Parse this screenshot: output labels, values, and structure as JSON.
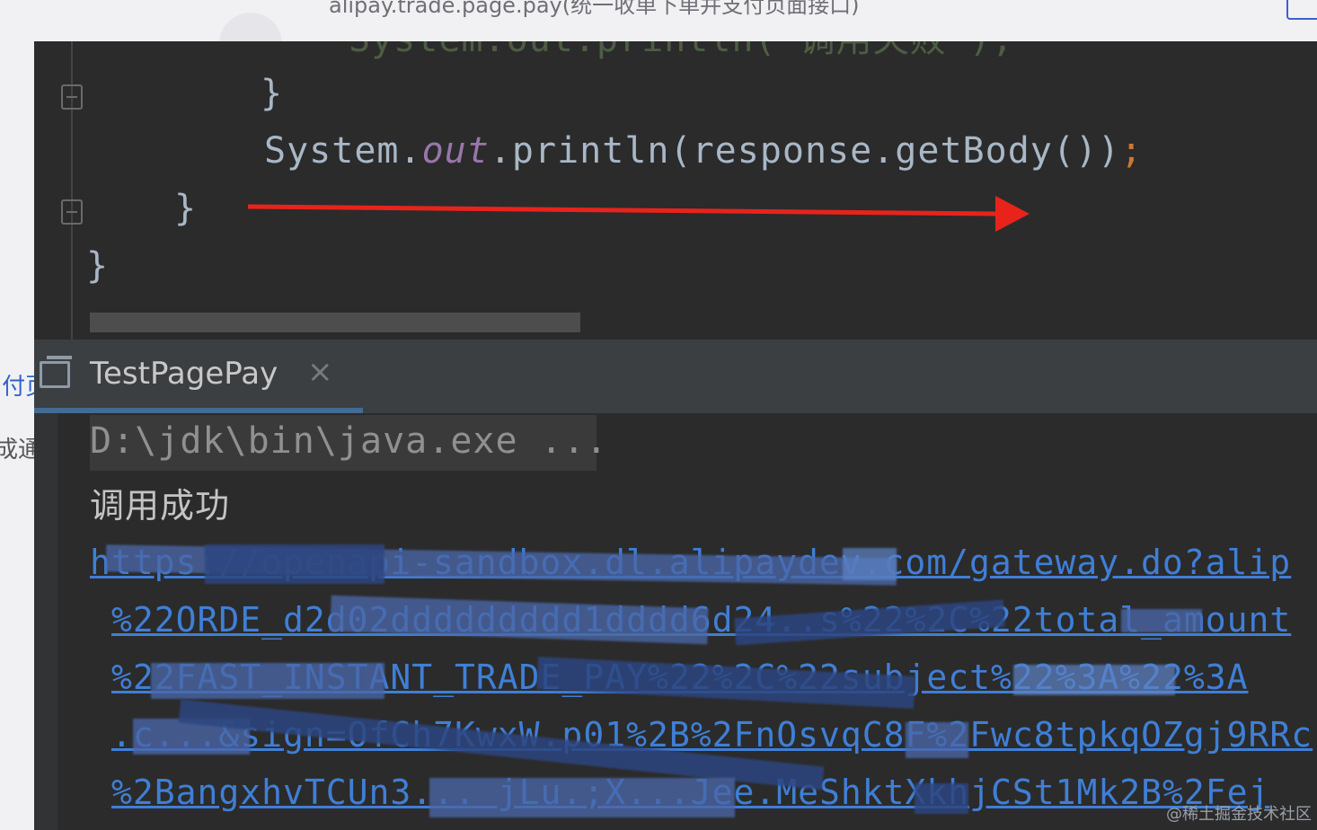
{
  "background_page": {
    "title": "alipay.trade.page.pay(统一收单下单并支付页面接口)",
    "left_link_text": "(付页",
    "left_text": "成通知"
  },
  "editor": {
    "line_top": "System.out.println(\"调用失败\");",
    "brace_1": "}",
    "print_call": {
      "obj": "System.",
      "field": "out",
      "rest": ".println(response.getBody())",
      "semi": ";"
    },
    "brace_2": "}",
    "brace_3": "}",
    "annotation_arrow_color": "#e8231c"
  },
  "run_window": {
    "tab_label": "TestPagePay",
    "close_glyph": "×",
    "console": {
      "command": "D:\\jdk\\bin\\java.exe ...",
      "status": "调用成功",
      "url_lines": [
        "https://openapi-sandbox.dl.alipaydev.com/gateway.do?alip",
        "%22ORDE_d2d02ddddddddd1dddd6d24..s%22%2C%22total_amount",
        "%22FAST_INSTANT_TRADE_PAY%22%2C%22subject%22%3A%22%3A",
        ".c...&sign=OfCh7KwxW.p01%2B%2FnOsvqC8F%2Fwc8tpkqOZgj9RRc",
        "%2BangxhvTCUn3... jLu.;X...Jee.MeShktXkhjCSt1Mk2B%2Fej"
      ]
    }
  },
  "watermark": "@稀土掘金技术社区"
}
